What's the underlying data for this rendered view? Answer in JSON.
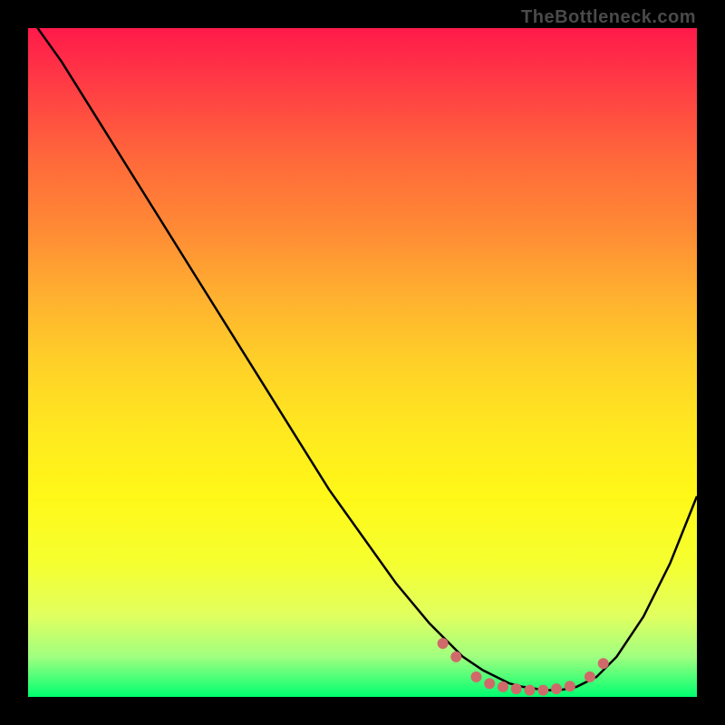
{
  "watermark": "TheBottleneck.com",
  "colors": {
    "curve_stroke": "#000000",
    "dot_fill": "#d06a6a",
    "gradient_top": "#ff1a4a",
    "gradient_bottom": "#00ff70"
  },
  "chart_data": {
    "type": "line",
    "title": "",
    "xlabel": "",
    "ylabel": "",
    "xlim": [
      0,
      100
    ],
    "ylim": [
      0,
      100
    ],
    "x": [
      0,
      5,
      10,
      15,
      20,
      25,
      30,
      35,
      40,
      45,
      50,
      55,
      60,
      62,
      65,
      68,
      70,
      72,
      74,
      76,
      78,
      80,
      82,
      85,
      88,
      92,
      96,
      100
    ],
    "values": [
      102,
      95,
      87,
      79,
      71,
      63,
      55,
      47,
      39,
      31,
      24,
      17,
      11,
      9,
      6,
      4,
      3,
      2,
      1.5,
      1.2,
      1,
      1.1,
      1.5,
      3,
      6,
      12,
      20,
      30
    ],
    "annotations_dots": [
      {
        "x": 62,
        "y": 8
      },
      {
        "x": 64,
        "y": 6
      },
      {
        "x": 67,
        "y": 3
      },
      {
        "x": 69,
        "y": 2
      },
      {
        "x": 71,
        "y": 1.5
      },
      {
        "x": 73,
        "y": 1.2
      },
      {
        "x": 75,
        "y": 1
      },
      {
        "x": 77,
        "y": 1
      },
      {
        "x": 79,
        "y": 1.2
      },
      {
        "x": 81,
        "y": 1.6
      },
      {
        "x": 84,
        "y": 3
      },
      {
        "x": 86,
        "y": 5
      }
    ]
  }
}
